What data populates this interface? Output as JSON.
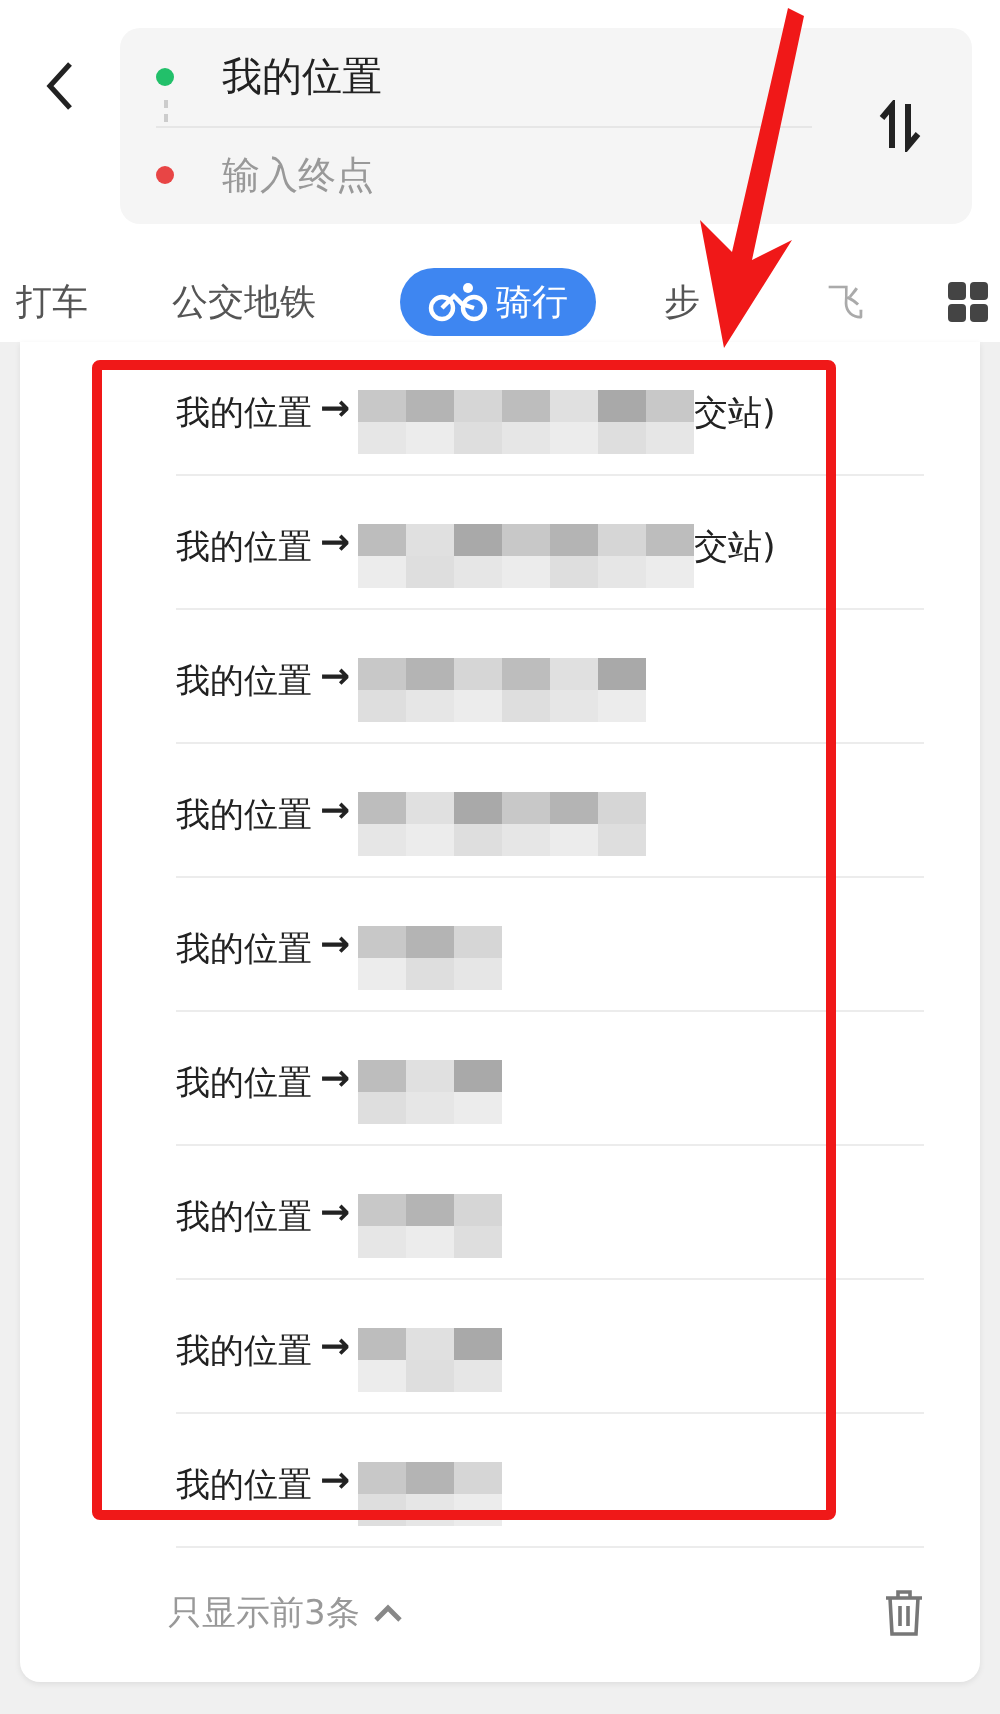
{
  "route": {
    "origin": "我的位置",
    "destination_placeholder": "输入终点"
  },
  "modes": [
    {
      "label": "打车",
      "selected": false,
      "kind": "text"
    },
    {
      "label": "公交地铁",
      "selected": false,
      "kind": "text"
    },
    {
      "label": "骑行",
      "selected": true,
      "kind": "bike"
    },
    {
      "label": "步",
      "selected": false,
      "kind": "text"
    },
    {
      "label": "飞",
      "selected": false,
      "kind": "text"
    }
  ],
  "history": [
    {
      "origin": "我的位置",
      "arrow": "→",
      "suffix": "交站)"
    },
    {
      "origin": "我的位置",
      "arrow": "→",
      "suffix": "交站)"
    },
    {
      "origin": "我的位置",
      "arrow": "→"
    },
    {
      "origin": "我的位置",
      "arrow": "→"
    },
    {
      "origin": "我的位置",
      "arrow": "→"
    },
    {
      "origin": "我的位置",
      "arrow": "→"
    },
    {
      "origin": "我的位置",
      "arrow": "→"
    },
    {
      "origin": "我的位置",
      "arrow": "→"
    },
    {
      "origin": "我的位置",
      "arrow": "→"
    }
  ],
  "footer": {
    "label": "只显示前3条"
  }
}
